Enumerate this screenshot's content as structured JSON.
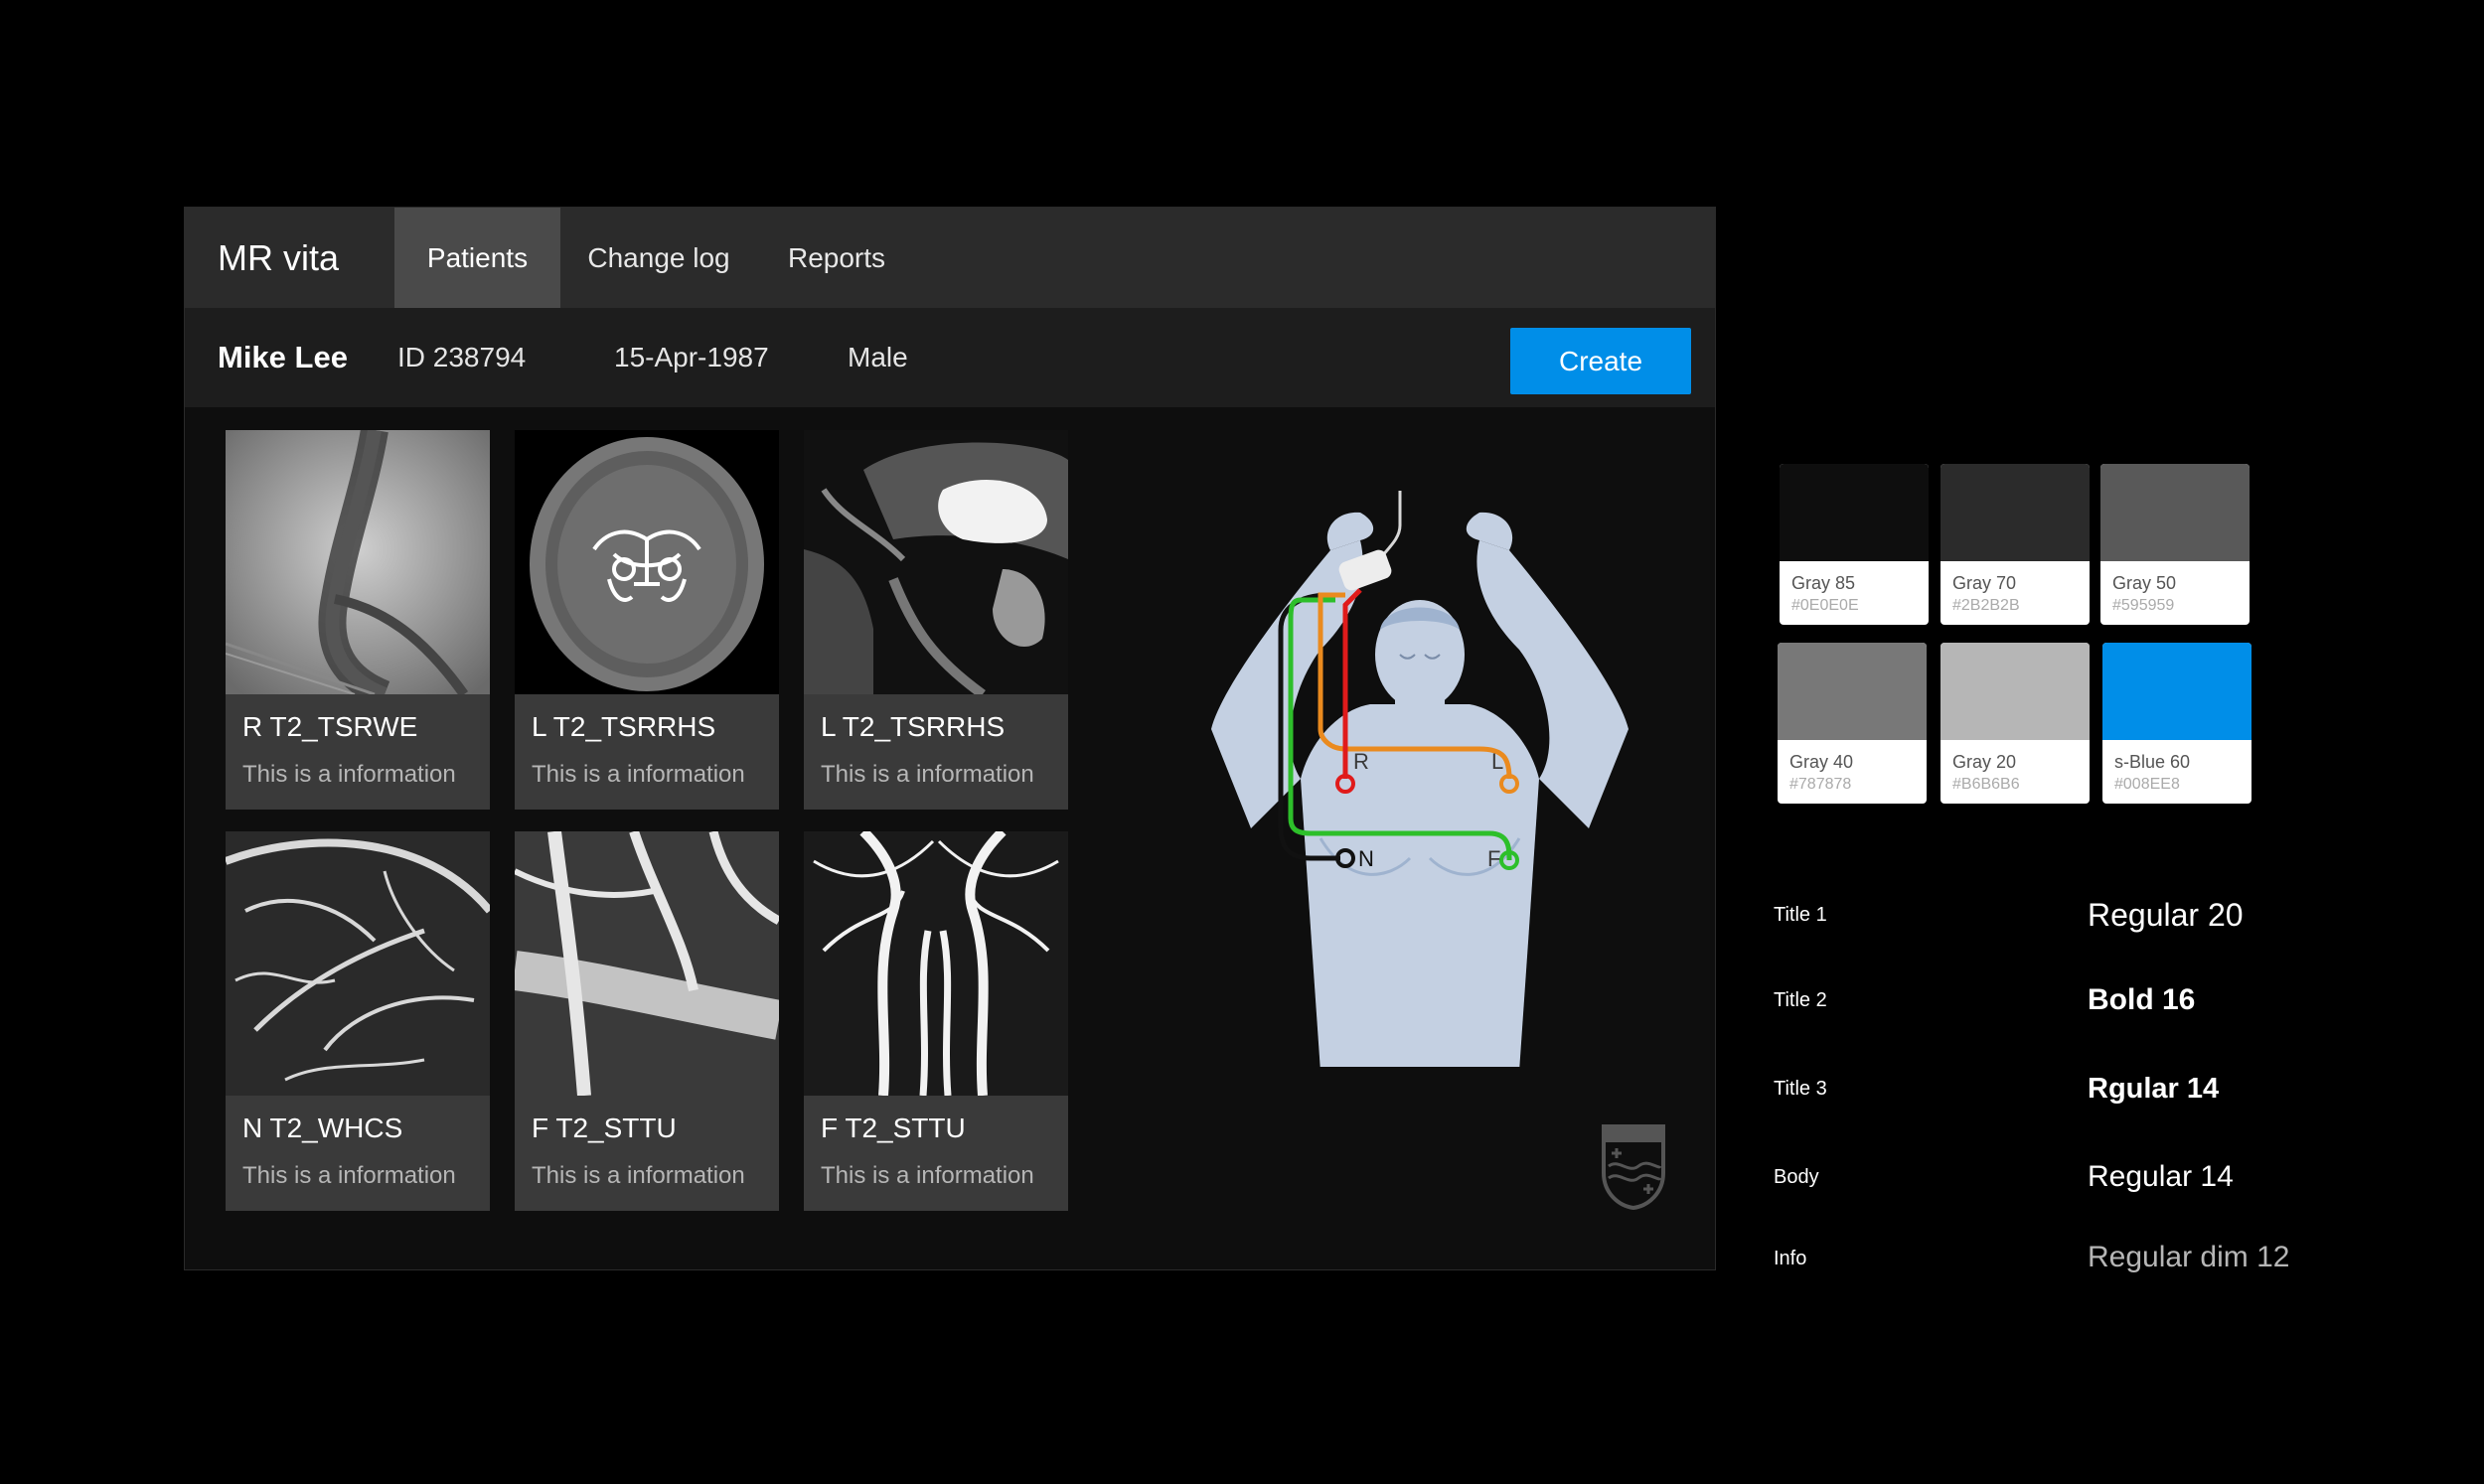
{
  "app": {
    "brand": "MR vita",
    "tabs": [
      {
        "label": "Patients",
        "active": true
      },
      {
        "label": "Change log",
        "active": false
      },
      {
        "label": "Reports",
        "active": false
      }
    ]
  },
  "patient": {
    "name": "Mike Lee",
    "id": "ID 238794",
    "dob": "15-Apr-1987",
    "sex": "Male",
    "create_label": "Create"
  },
  "cards": [
    {
      "title": "R T2_TSRWE",
      "info": "This is a information",
      "image": "angiography-xray"
    },
    {
      "title": "L T2_TSRRHS",
      "info": "This is a information",
      "image": "brain-axial-mra"
    },
    {
      "title": "L T2_TSRRHS",
      "info": "This is a information",
      "image": "sagittal-mri"
    },
    {
      "title": "N T2_WHCS",
      "info": "This is a information",
      "image": "vessel-mip"
    },
    {
      "title": "F T2_STTU",
      "info": "This is a information",
      "image": "vessel-closeup"
    },
    {
      "title": "F T2_STTU",
      "info": "This is a information",
      "image": "neck-angiogram"
    }
  ],
  "ecg_figure": {
    "labels": {
      "right": "R",
      "left": "L",
      "neutral": "N",
      "foot": "F"
    },
    "colors": {
      "body": "#c4d0e2",
      "red": "#e01b1b",
      "orange": "#ea8a1e",
      "green": "#2dbf2a",
      "black": "#111111"
    }
  },
  "brand_logo": "philips-shield-logo",
  "palette": [
    {
      "name": "Gray 85",
      "hex": "#0E0E0E"
    },
    {
      "name": "Gray 70",
      "hex": "#2B2B2B"
    },
    {
      "name": "Gray 50",
      "hex": "#595959"
    },
    {
      "name": "Gray 40",
      "hex": "#787878"
    },
    {
      "name": "Gray 20",
      "hex": "#B6B6B6"
    },
    {
      "name": "s-Blue 60",
      "hex": "#008EE8"
    }
  ],
  "typography": [
    {
      "label": "Title 1",
      "value": "Regular 20"
    },
    {
      "label": "Title 2",
      "value": "Bold 16"
    },
    {
      "label": "Title 3",
      "value": "Rgular 14"
    },
    {
      "label": "Body",
      "value": "Regular 14"
    },
    {
      "label": "Info",
      "value": "Regular dim 12"
    }
  ]
}
